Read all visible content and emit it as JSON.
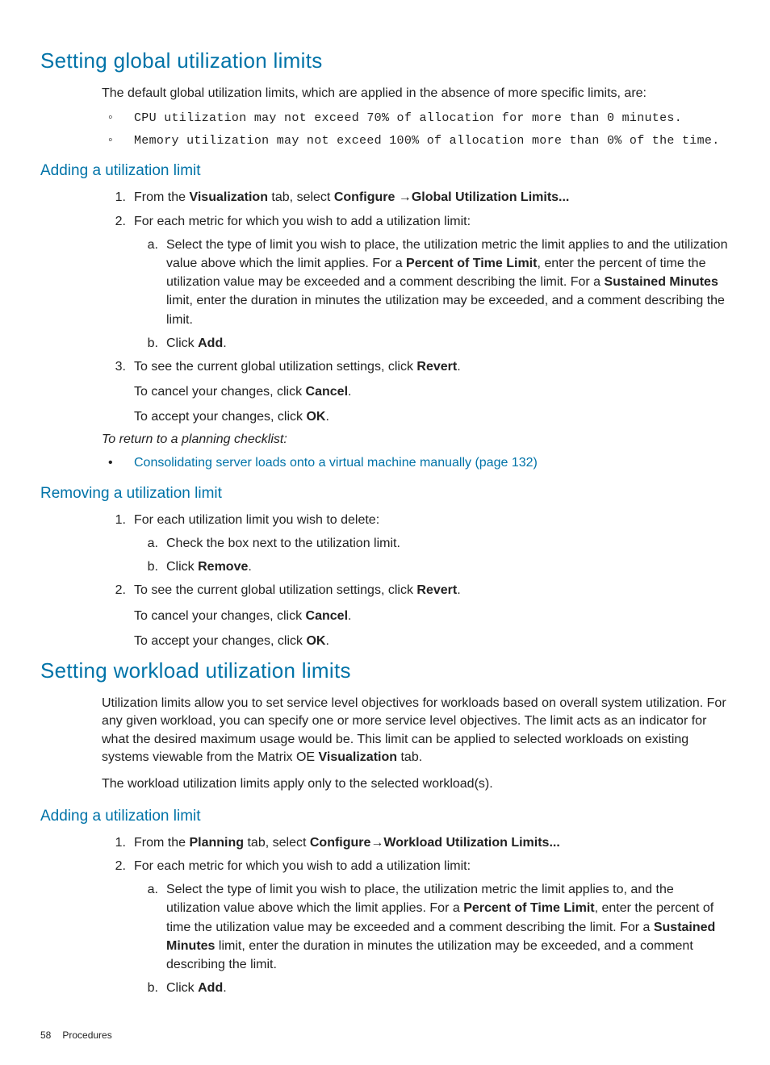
{
  "h1a": "Setting global utilization limits",
  "p_intro1": "The default global utilization limits, which are applied in the absence of more specific limits, are:",
  "bullets1": {
    "b1": "CPU utilization may not exceed 70% of allocation for more than 0 minutes.",
    "b2": "Memory utilization may not exceed 100% of allocation more than 0% of the time."
  },
  "h2_add1": "Adding a utilization limit",
  "add1": {
    "s1a": "From the ",
    "s1b": "Visualization",
    "s1c": " tab, select ",
    "s1d": "Configure",
    "s1e": " →",
    "s1f": "Global Utilization Limits...",
    "s2": "For each metric for which you wish to add a utilization limit:",
    "s2a_a": "Select the type of limit you wish to place, the utilization metric the limit applies to and the utilization value above which the limit applies. For a ",
    "s2a_b": "Percent of Time Limit",
    "s2a_c": ", enter the percent of time the utilization value may be exceeded and a comment describing the limit. For a ",
    "s2a_d": "Sustained Minutes",
    "s2a_e": " limit, enter the duration in minutes the utilization may be exceeded, and a comment describing the limit.",
    "s2b_a": "Click ",
    "s2b_b": "Add",
    "s2b_c": ".",
    "s3a": "To see the current global utilization settings, click ",
    "s3b": "Revert",
    "s3c": ".",
    "s3d": "To cancel your changes, click ",
    "s3e": "Cancel",
    "s3f": ".",
    "s3g": "To accept your changes, click ",
    "s3h": "OK",
    "s3i": "."
  },
  "return_note": "To return to a planning checklist:",
  "link1": "Consolidating server loads onto a virtual machine manually (page 132)",
  "h2_rem": "Removing a utilization limit",
  "rem": {
    "s1": "For each utilization limit you wish to delete:",
    "s1a": "Check the box next to the utilization limit.",
    "s1b_a": "Click ",
    "s1b_b": "Remove",
    "s1b_c": ".",
    "s2a": "To see the current global utilization settings, click ",
    "s2b": "Revert",
    "s2c": ".",
    "s2d": "To cancel your changes, click ",
    "s2e": "Cancel",
    "s2f": ".",
    "s2g": "To accept your changes, click ",
    "s2h": "OK",
    "s2i": "."
  },
  "h1b": "Setting workload utilization limits",
  "p_intro2a": "Utilization limits allow you to set service level objectives for workloads based on overall system utilization. For any given workload, you can specify one or more service level objectives. The limit acts as an indicator for what the desired maximum usage would be. This limit can be applied to selected workloads on existing systems viewable from the Matrix OE ",
  "p_intro2b": "Visualization",
  "p_intro2c": " tab.",
  "p_intro3": "The workload utilization limits apply only to the selected workload(s).",
  "h2_add2": "Adding a utilization limit",
  "add2": {
    "s1a": "From the ",
    "s1b": "Planning",
    "s1c": " tab, select ",
    "s1d": "Configure",
    "s1e": "→",
    "s1f": "Workload Utilization Limits...",
    "s2": "For each metric for which you wish to add a utilization limit:",
    "s2a_a": "Select the type of limit you wish to place, the utilization metric the limit applies to, and the utilization value above which the limit applies. For a ",
    "s2a_b": "Percent of Time Limit",
    "s2a_c": ", enter the percent of time the utilization value may be exceeded and a comment describing the limit. For a ",
    "s2a_d": "Sustained Minutes",
    "s2a_e": " limit, enter the duration in minutes the utilization may be exceeded, and a comment describing the limit.",
    "s2b_a": "Click ",
    "s2b_b": "Add",
    "s2b_c": "."
  },
  "footer": {
    "page": "58",
    "chapter": "Procedures"
  }
}
